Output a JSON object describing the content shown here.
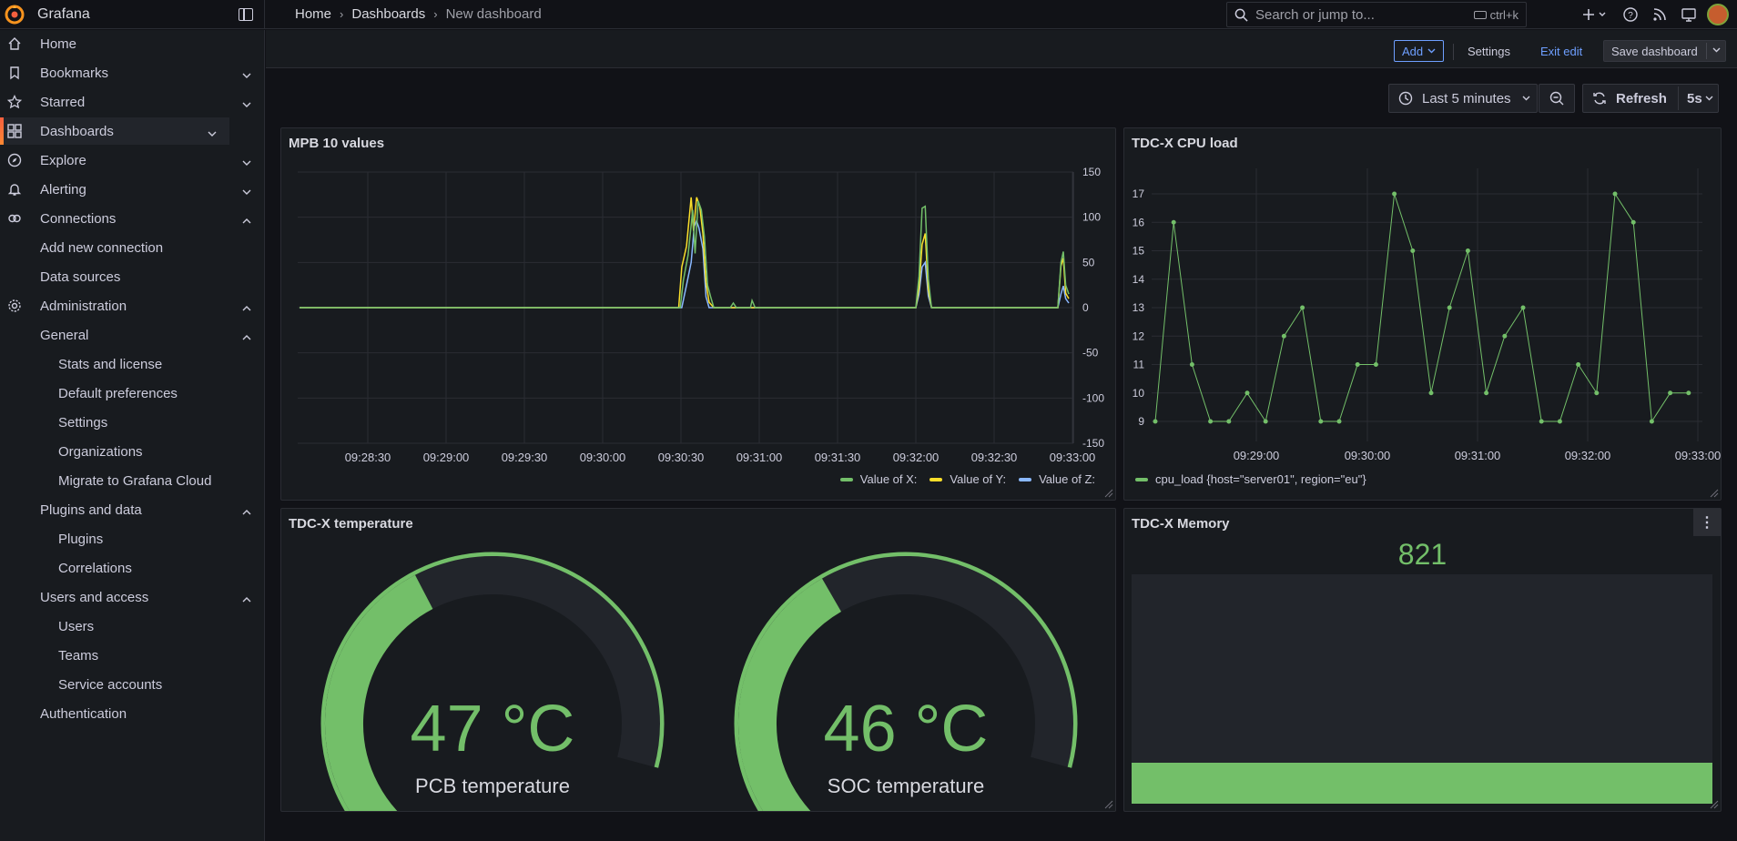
{
  "app": {
    "name": "Grafana"
  },
  "breadcrumb": [
    "Home",
    "Dashboards",
    "New dashboard"
  ],
  "search": {
    "placeholder": "Search or jump to...",
    "shortcut": "ctrl+k"
  },
  "nav": [
    {
      "id": "home",
      "label": "Home",
      "icon": "home-icon",
      "level": 0,
      "chevron": ""
    },
    {
      "id": "bookmarks",
      "label": "Bookmarks",
      "icon": "bookmark-icon",
      "level": 0,
      "chevron": "down"
    },
    {
      "id": "starred",
      "label": "Starred",
      "icon": "star-icon",
      "level": 0,
      "chevron": "down"
    },
    {
      "id": "dashboards",
      "label": "Dashboards",
      "icon": "apps-icon",
      "level": 0,
      "chevron": "down",
      "active": true
    },
    {
      "id": "explore",
      "label": "Explore",
      "icon": "compass-icon",
      "level": 0,
      "chevron": "down"
    },
    {
      "id": "alerting",
      "label": "Alerting",
      "icon": "bell-icon",
      "level": 0,
      "chevron": "down"
    },
    {
      "id": "connections",
      "label": "Connections",
      "icon": "link-icon",
      "level": 0,
      "chevron": "up"
    },
    {
      "id": "add-new-connection",
      "label": "Add new connection",
      "level": 1,
      "chevron": ""
    },
    {
      "id": "data-sources",
      "label": "Data sources",
      "level": 1,
      "chevron": ""
    },
    {
      "id": "administration",
      "label": "Administration",
      "icon": "cog-icon",
      "level": 0,
      "chevron": "up"
    },
    {
      "id": "general",
      "label": "General",
      "level": 1,
      "chevron": "up"
    },
    {
      "id": "stats-and-license",
      "label": "Stats and license",
      "level": 2,
      "chevron": ""
    },
    {
      "id": "default-preferences",
      "label": "Default preferences",
      "level": 2,
      "chevron": ""
    },
    {
      "id": "settings",
      "label": "Settings",
      "level": 2,
      "chevron": ""
    },
    {
      "id": "organizations",
      "label": "Organizations",
      "level": 2,
      "chevron": ""
    },
    {
      "id": "migrate-to-grafana-cloud",
      "label": "Migrate to Grafana Cloud",
      "level": 2,
      "chevron": ""
    },
    {
      "id": "plugins-and-data",
      "label": "Plugins and data",
      "level": 1,
      "chevron": "up"
    },
    {
      "id": "plugins",
      "label": "Plugins",
      "level": 2,
      "chevron": ""
    },
    {
      "id": "correlations",
      "label": "Correlations",
      "level": 2,
      "chevron": ""
    },
    {
      "id": "users-and-access",
      "label": "Users and access",
      "level": 1,
      "chevron": "up"
    },
    {
      "id": "users",
      "label": "Users",
      "level": 2,
      "chevron": ""
    },
    {
      "id": "teams",
      "label": "Teams",
      "level": 2,
      "chevron": ""
    },
    {
      "id": "service-accounts",
      "label": "Service accounts",
      "level": 2,
      "chevron": ""
    },
    {
      "id": "authentication",
      "label": "Authentication",
      "level": 1,
      "chevron": ""
    }
  ],
  "toolbar": {
    "add": "Add",
    "settings": "Settings",
    "exit_edit": "Exit edit",
    "save": "Save dashboard"
  },
  "time": {
    "range": "Last 5 minutes",
    "refresh": "Refresh",
    "interval": "5s"
  },
  "panels": {
    "mpb": {
      "title": "MPB 10 values",
      "chart_data": {
        "type": "line",
        "x": [
          "09:28:30",
          "09:29:00",
          "09:29:30",
          "09:30:00",
          "09:30:30",
          "09:31:00",
          "09:31:30",
          "09:32:00",
          "09:32:30",
          "09:33:00"
        ],
        "ylim": [
          -150,
          150
        ],
        "yticks": [
          150,
          100,
          50,
          0,
          -50,
          -100,
          -150
        ],
        "series": [
          {
            "name": "Value of X:",
            "color": "#73bf69",
            "points": [
              [
                0,
                0
              ],
              [
                470,
                0
              ],
              [
                488,
                0
              ],
              [
                492,
                30
              ],
              [
                498,
                58
              ],
              [
                504,
                108
              ],
              [
                507,
                60
              ],
              [
                511,
                118
              ],
              [
                515,
                108
              ],
              [
                519,
                78
              ],
              [
                523,
                25
              ],
              [
                527,
                12
              ],
              [
                531,
                0
              ],
              [
                552,
                0
              ],
              [
                556,
                5
              ],
              [
                560,
                0
              ],
              [
                578,
                0
              ],
              [
                580,
                8
              ],
              [
                584,
                0
              ],
              [
                790,
                0
              ],
              [
                794,
                35
              ],
              [
                798,
                110
              ],
              [
                802,
                112
              ],
              [
                806,
                32
              ],
              [
                810,
                0
              ],
              [
                972,
                0
              ],
              [
                976,
                50
              ],
              [
                979,
                62
              ],
              [
                982,
                25
              ],
              [
                986,
                15
              ]
            ]
          },
          {
            "name": "Value of Y:",
            "color": "#fade2a",
            "points": [
              [
                0,
                0
              ],
              [
                480,
                0
              ],
              [
                486,
                0
              ],
              [
                490,
                45
              ],
              [
                496,
                68
              ],
              [
                502,
                122
              ],
              [
                505,
                85
              ],
              [
                509,
                122
              ],
              [
                513,
                112
              ],
              [
                517,
                82
              ],
              [
                521,
                28
              ],
              [
                525,
                6
              ],
              [
                531,
                0
              ],
              [
                790,
                0
              ],
              [
                794,
                22
              ],
              [
                798,
                70
              ],
              [
                802,
                82
              ],
              [
                806,
                20
              ],
              [
                810,
                0
              ],
              [
                972,
                0
              ],
              [
                976,
                46
              ],
              [
                979,
                55
              ],
              [
                982,
                16
              ],
              [
                986,
                10
              ]
            ]
          },
          {
            "name": "Value of Z:",
            "color": "#8ab8ff",
            "points": [
              [
                0,
                0
              ],
              [
                490,
                0
              ],
              [
                496,
                25
              ],
              [
                502,
                50
              ],
              [
                506,
                90
              ],
              [
                509,
                96
              ],
              [
                512,
                88
              ],
              [
                517,
                65
              ],
              [
                521,
                12
              ],
              [
                525,
                0
              ],
              [
                790,
                0
              ],
              [
                794,
                15
              ],
              [
                798,
                45
              ],
              [
                802,
                50
              ],
              [
                806,
                13
              ],
              [
                810,
                0
              ],
              [
                972,
                0
              ],
              [
                976,
                15
              ],
              [
                979,
                24
              ],
              [
                982,
                10
              ],
              [
                986,
                5
              ]
            ]
          }
        ]
      }
    },
    "cpu": {
      "title": "TDC-X CPU load",
      "chart_data": {
        "type": "line",
        "x": [
          "09:29:00",
          "09:30:00",
          "09:31:00",
          "09:32:00",
          "09:33:00"
        ],
        "ylim": [
          9,
          17
        ],
        "yticks": [
          17,
          16,
          15,
          14,
          13,
          12,
          11,
          10,
          9
        ],
        "series": [
          {
            "name": "cpu_load {host=\"server01\", region=\"eu\"}",
            "color": "#73bf69",
            "values": [
              9,
              16,
              11,
              9,
              9,
              10,
              9,
              12,
              13,
              9,
              9,
              11,
              11,
              17,
              15,
              10,
              13,
              15,
              10,
              12,
              13,
              9,
              9,
              11,
              10,
              17,
              16,
              9,
              10,
              10
            ]
          }
        ]
      }
    },
    "temp": {
      "title": "TDC-X temperature",
      "gauges": [
        {
          "value": "47 °C",
          "label": "PCB temperature",
          "fraction": 0.47
        },
        {
          "value": "46 °C",
          "label": "SOC temperature",
          "fraction": 0.46
        }
      ]
    },
    "memory": {
      "title": "TDC-X Memory",
      "value": "821",
      "fill_fraction": 0.18
    }
  }
}
